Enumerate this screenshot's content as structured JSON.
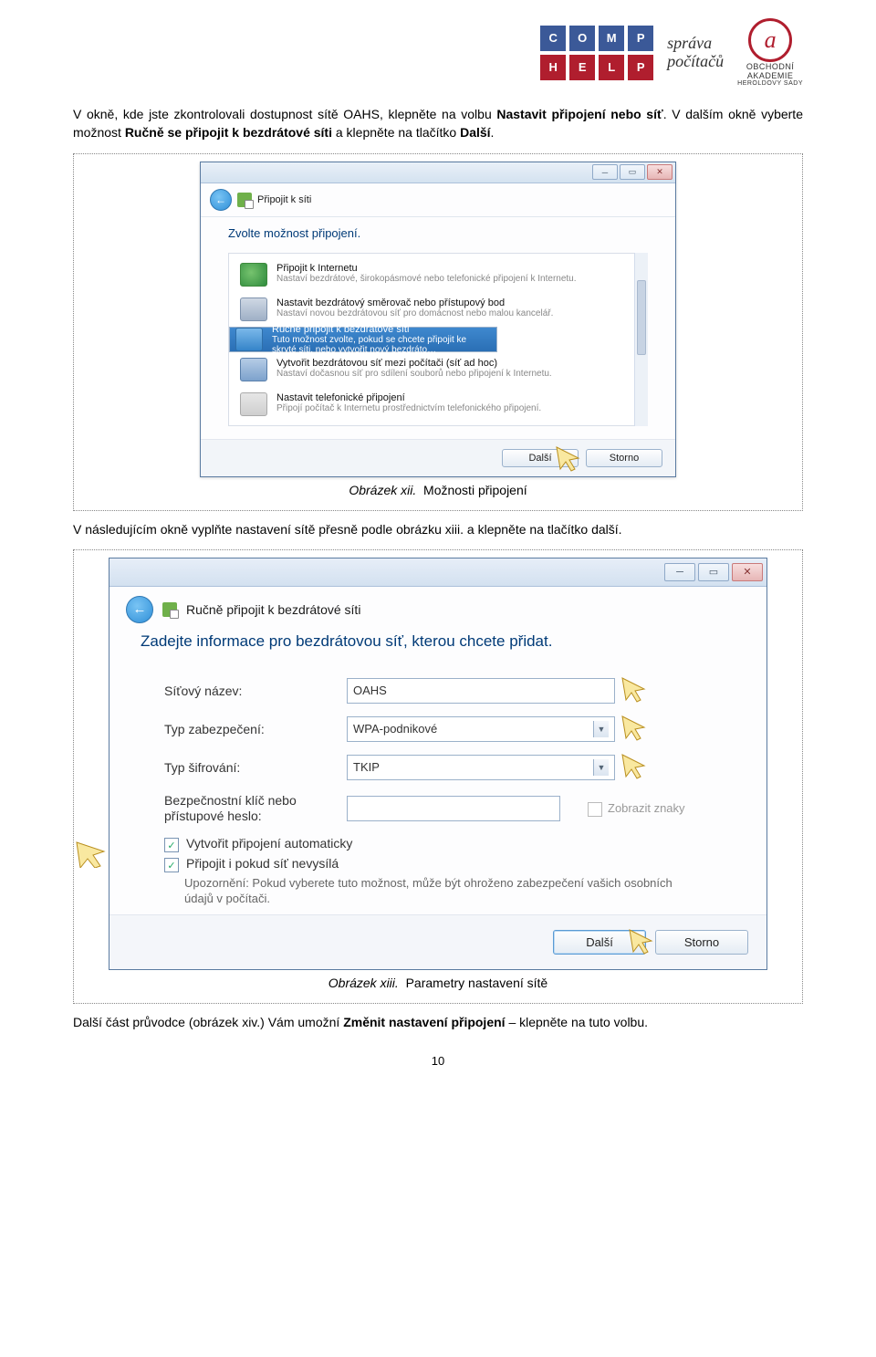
{
  "header": {
    "comphelp": [
      "C",
      "O",
      "M",
      "P",
      "H",
      "E",
      "L",
      "P"
    ],
    "sprava": "správa\npočítačů",
    "oa_line1": "OBCHODNÍ",
    "oa_line2": "AKADEMIE",
    "oa_line3": "HEROLDOVY SADY"
  },
  "para1_a": "V okně, kde jste zkontrolovali dostupnost sítě OAHS, klepněte na volbu ",
  "para1_b": "Nastavit připojení nebo síť",
  "para1_c": ". V dalším okně vyberte možnost ",
  "para1_d": "Ručně se připojit k bezdrátové síti",
  "para1_e": " a klepněte na tlačítko ",
  "para1_f": "Další",
  "para1_g": ".",
  "dialog1": {
    "nav_label": "Připojit k síti",
    "heading": "Zvolte možnost připojení.",
    "options": [
      {
        "t1": "Připojit k Internetu",
        "t2": "Nastaví bezdrátové, širokopásmové nebo telefonické připojení k Internetu."
      },
      {
        "t1": "Nastavit bezdrátový směrovač nebo přístupový bod",
        "t2": "Nastaví novou bezdrátovou síť pro domácnost nebo malou kancelář."
      },
      {
        "t1": "Ručně připojit k bezdrátové síti",
        "t2": "Tuto možnost zvolte, pokud se chcete připojit ke skryté síti, nebo vytvořit nový bezdráto…"
      },
      {
        "t1": "Vytvořit bezdrátovou síť mezi počítači (síť ad hoc)",
        "t2": "Nastaví dočasnou síť pro sdílení souborů nebo připojení k Internetu."
      },
      {
        "t1": "Nastavit telefonické připojení",
        "t2": "Připojí počítač k Internetu prostřednictvím telefonického připojení."
      }
    ],
    "btn_next": "Další",
    "btn_cancel": "Storno"
  },
  "caption1_lbl": "Obrázek xii.",
  "caption1_txt": "Možnosti připojení",
  "para2": "V následujícím okně vyplňte nastavení sítě přesně podle obrázku xiii. a klepněte na tlačítko další.",
  "dialog2": {
    "nav_label": "Ručně připojit k bezdrátové síti",
    "heading": "Zadejte informace pro bezdrátovou síť, kterou chcete přidat.",
    "lbl_name": "Síťový název:",
    "val_name": "OAHS",
    "lbl_sec": "Typ zabezpečení:",
    "val_sec": "WPA-podnikové",
    "lbl_enc": "Typ šifrování:",
    "val_enc": "TKIP",
    "lbl_key": "Bezpečnostní klíč nebo přístupové heslo:",
    "show_chars": "Zobrazit znaky",
    "chk_auto": "Vytvořit připojení automaticky",
    "chk_hidden": "Připojit i pokud síť nevysílá",
    "warn": "Upozornění: Pokud vyberete tuto možnost, může být ohroženo zabezpečení vašich osobních údajů v počítači.",
    "btn_next": "Další",
    "btn_cancel": "Storno"
  },
  "caption2_lbl": "Obrázek xiii.",
  "caption2_txt": "Parametry nastavení sítě",
  "para3_a": "Další část průvodce (obrázek xiv.) Vám umožní ",
  "para3_b": "Změnit nastavení připojení",
  "para3_c": " – klepněte na tuto volbu.",
  "page_number": "10"
}
